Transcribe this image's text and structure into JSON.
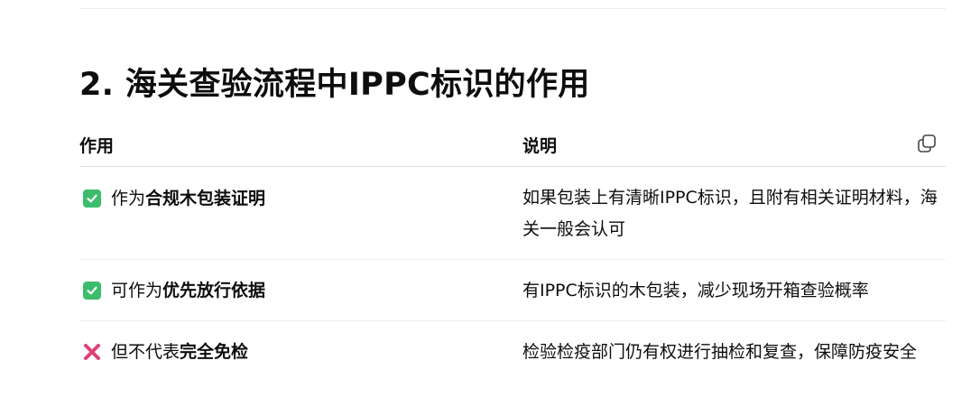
{
  "heading": "2. 海关查验流程中IPPC标识的作用",
  "table": {
    "headers": [
      "作用",
      "说明"
    ],
    "copy_icon": "copy-icon",
    "rows": [
      {
        "icon": "check-mark-icon",
        "role_prefix": "作为",
        "role_bold": "合规木包装证明",
        "desc": "如果包装上有清晰IPPC标识，且附有相关证明材料，海关一般会认可"
      },
      {
        "icon": "check-mark-icon",
        "role_prefix": "可作为",
        "role_bold": "优先放行依据",
        "desc": "有IPPC标识的木包装，减少现场开箱查验概率"
      },
      {
        "icon": "cross-mark-icon",
        "role_prefix": "但不代表",
        "role_bold": "完全免检",
        "desc": "检验检疫部门仍有权进行抽检和复查，保障防疫安全"
      }
    ]
  },
  "colors": {
    "check": "#3dbd6c",
    "cross": "#e0407a",
    "text": "#0d0d0d"
  }
}
